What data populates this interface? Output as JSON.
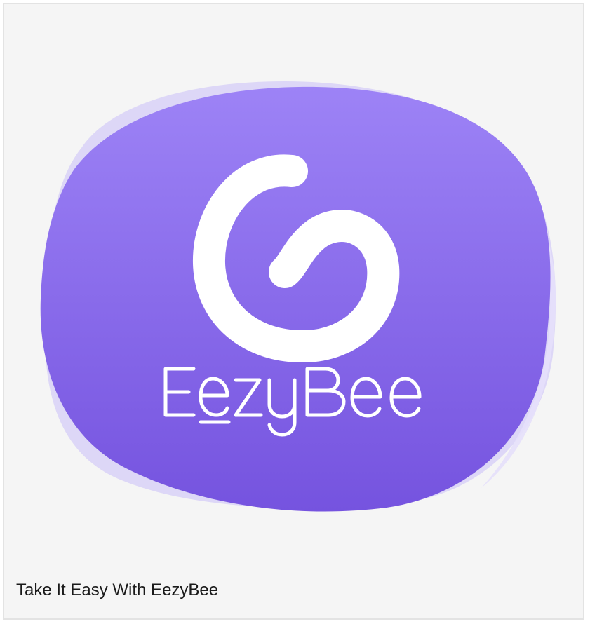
{
  "logo": {
    "brand_name": "EezyBee",
    "icon": "swirl-e-icon",
    "colors": {
      "blob_top": "#9d83f6",
      "blob_bottom": "#7553df",
      "blob_halo": "#c9bdf8",
      "blob_halo_light": "#e6e0fb",
      "mark": "#ffffff"
    }
  },
  "caption": {
    "text": "Take It Easy With EezyBee"
  },
  "card": {
    "background": "#f5f5f5",
    "border": "#e3e3e3"
  }
}
